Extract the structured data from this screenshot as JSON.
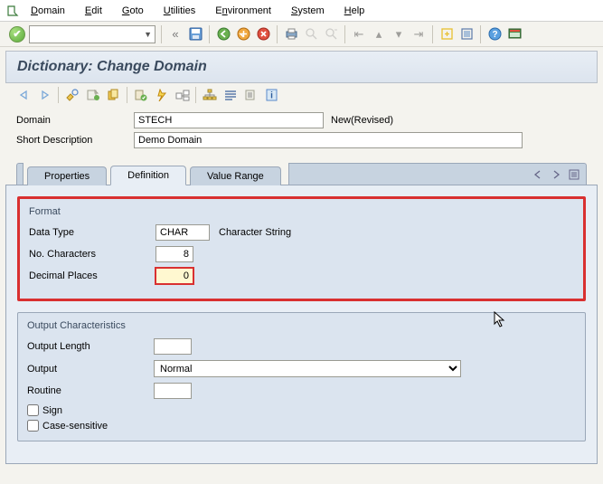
{
  "menu": {
    "domain": "Domain",
    "edit": "Edit",
    "goto": "Goto",
    "utilities": "Utilities",
    "environment": "Environment",
    "system": "System",
    "help": "Help"
  },
  "header": {
    "title": "Dictionary: Change Domain"
  },
  "form": {
    "domain_label": "Domain",
    "domain_value": "STECH",
    "domain_status": "New(Revised)",
    "shortdesc_label": "Short Description",
    "shortdesc_value": "Demo Domain"
  },
  "tabs": {
    "properties": "Properties",
    "definition": "Definition",
    "valuerange": "Value Range"
  },
  "format": {
    "title": "Format",
    "datatype_label": "Data Type",
    "datatype_value": "CHAR",
    "datatype_desc": "Character String",
    "nochars_label": "No. Characters",
    "nochars_value": "8",
    "decimals_label": "Decimal Places",
    "decimals_value": "0"
  },
  "output": {
    "title": "Output Characteristics",
    "length_label": "Output Length",
    "length_value": "",
    "output_label": "Output",
    "output_value": "Normal",
    "routine_label": "Routine",
    "routine_value": "",
    "sign_label": "Sign",
    "case_label": "Case-sensitive"
  }
}
